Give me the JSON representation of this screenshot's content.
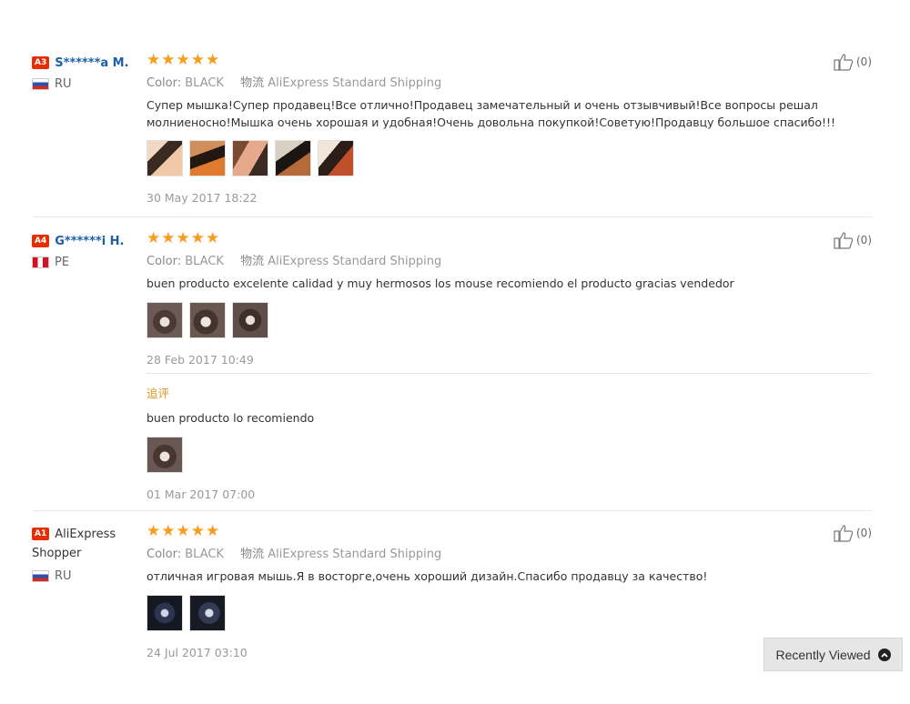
{
  "labels": {
    "color_key": "Color:",
    "shipping_key": "物流",
    "followup_label": "追评",
    "recently_viewed": "Recently Viewed"
  },
  "reviews": [
    {
      "badge": "A3",
      "user": "S******a M.",
      "country": "RU",
      "stars": "★★★★★",
      "color": "BLACK",
      "shipping": "AliExpress Standard Shipping",
      "text": "Супер мышка!Супер продавец!Все отлично!Продавец замечательный и очень отзывчивый!Все вопросы решал молниеносно!Мышка очень хорошая и удобная!Очень довольна покупкой!Советую!Продавцу большое спасибо!!!",
      "photo_count": 5,
      "date": "30 May 2017 18:22",
      "helpful": "(0)"
    },
    {
      "badge": "A4",
      "user": "G******i H.",
      "country": "PE",
      "stars": "★★★★★",
      "color": "BLACK",
      "shipping": "AliExpress Standard Shipping",
      "text": "buen producto excelente calidad y muy hermosos los mouse recomiendo el producto gracias vendedor",
      "photo_count": 3,
      "date": "28 Feb 2017 10:49",
      "helpful": "(0)",
      "followup": {
        "text": "buen producto lo recomiendo",
        "photo_count": 1,
        "date": "01 Mar 2017 07:00"
      }
    },
    {
      "badge": "A1",
      "user": "AliExpress Shopper",
      "country": "RU",
      "stars": "★★★★★",
      "color": "BLACK",
      "shipping": "AliExpress Standard Shipping",
      "text": "отличная игровая мышь.Я в восторге,очень хороший дизайн.Спасибо продавцу за качество!",
      "photo_count": 2,
      "date": "24 Jul 2017 03:10",
      "helpful": "(0)"
    }
  ],
  "colors": {
    "star": "#f79c1c",
    "badge": "#e62e04",
    "username": "#1c5fa8",
    "followup": "#e5941e"
  }
}
